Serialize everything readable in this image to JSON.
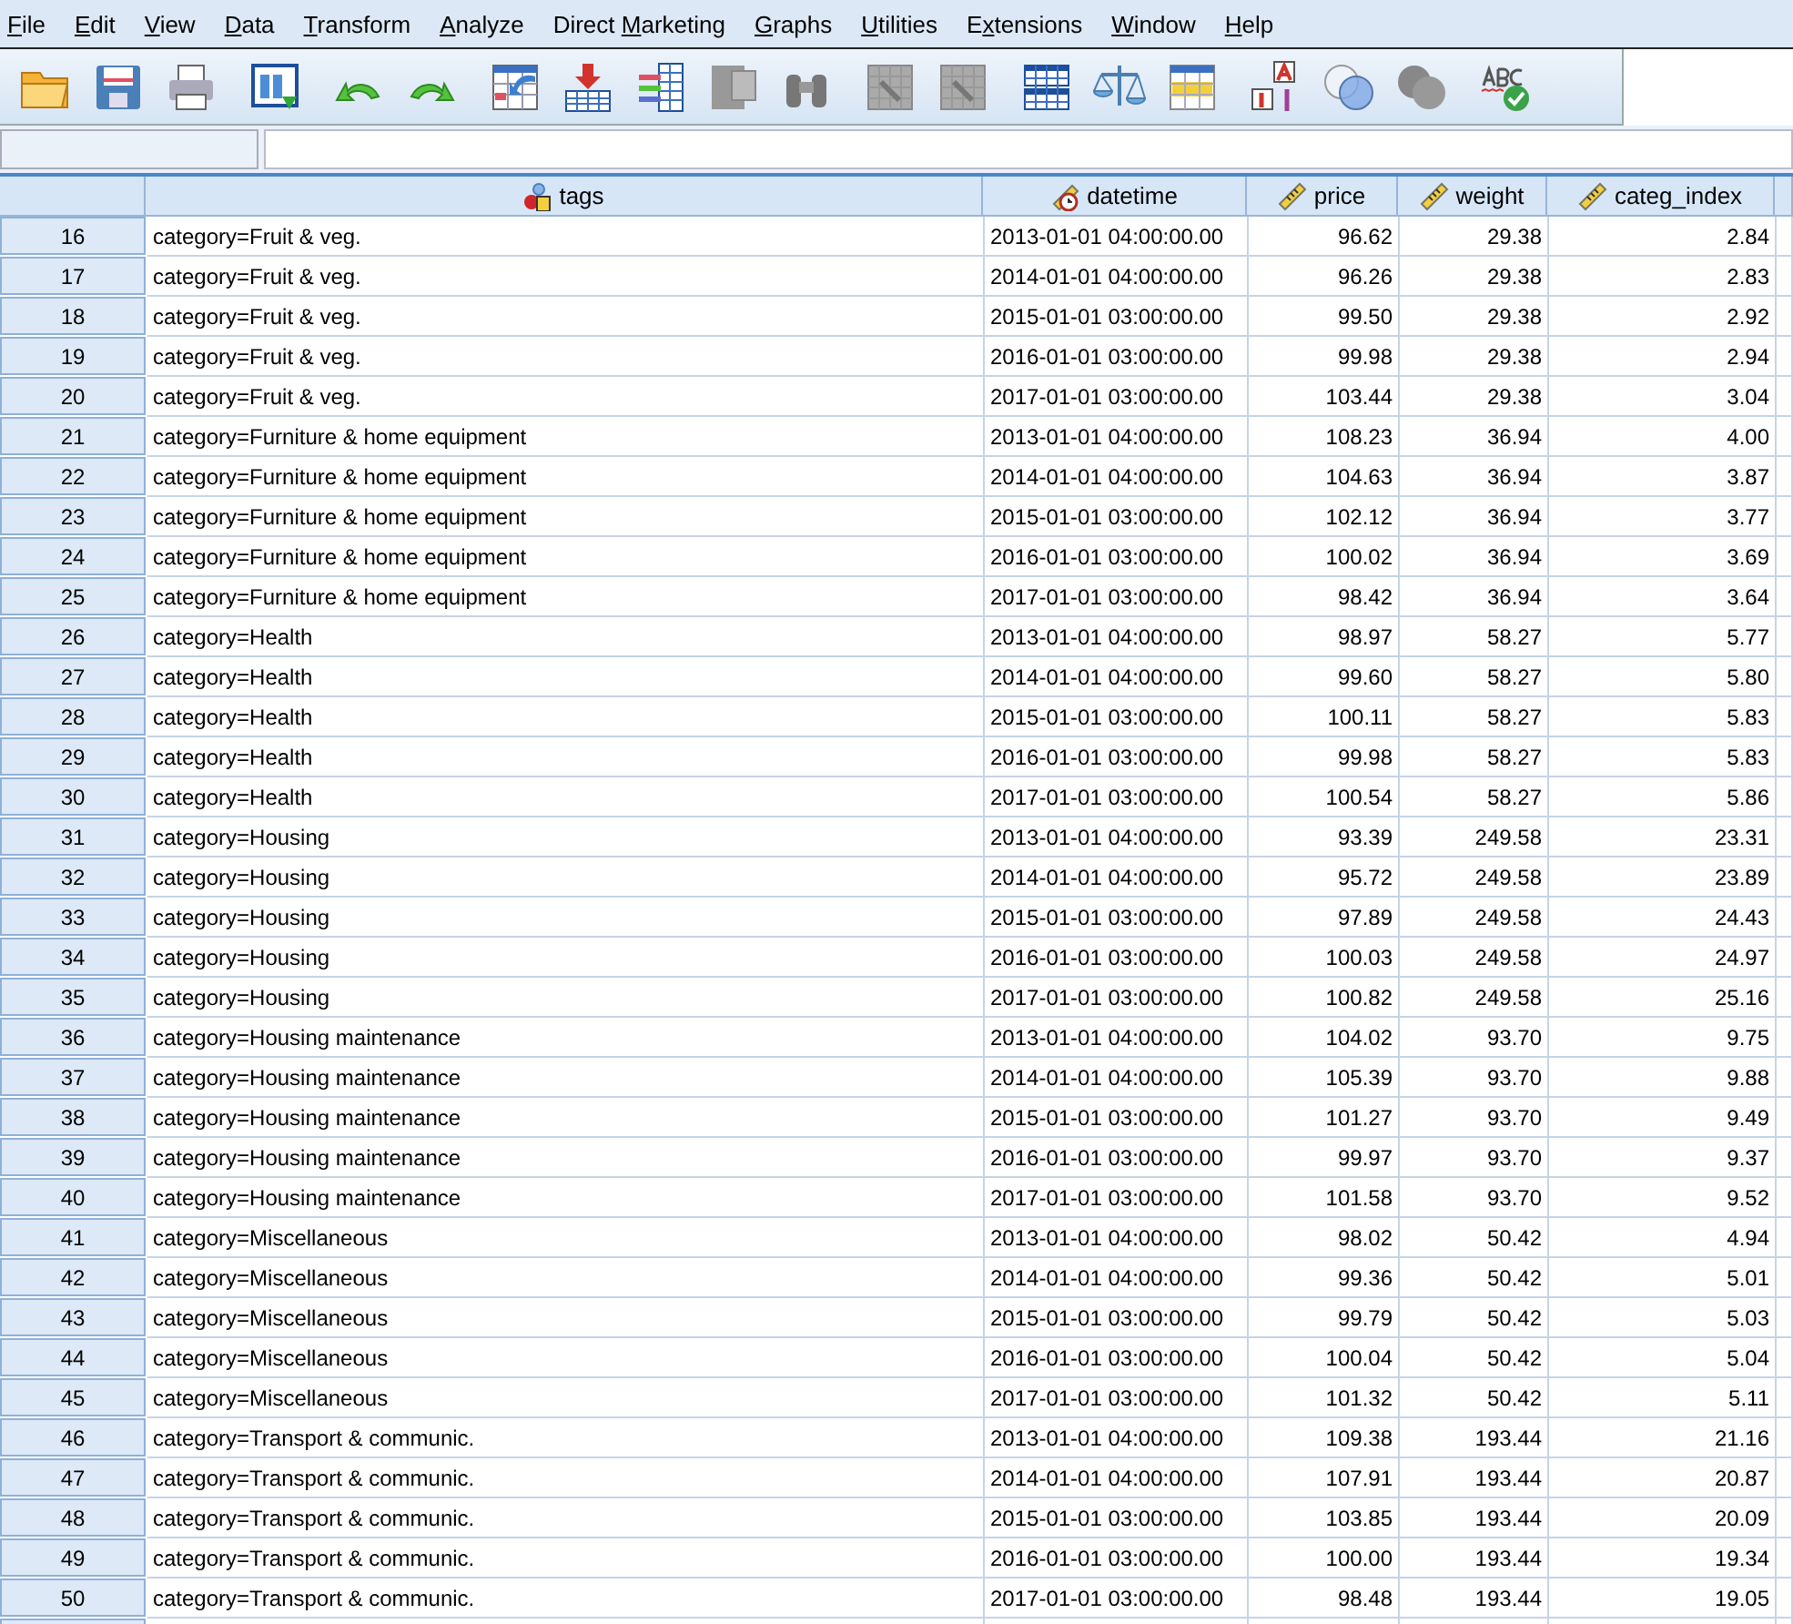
{
  "menu": [
    {
      "key": "F",
      "after": "ile"
    },
    {
      "key": "E",
      "after": "dit"
    },
    {
      "key": "V",
      "after": "iew"
    },
    {
      "key": "D",
      "after": "ata"
    },
    {
      "key": "T",
      "after": "ransform"
    },
    {
      "key": "A",
      "after": "nalyze"
    },
    {
      "before": "Direct ",
      "key": "M",
      "after": "arketing"
    },
    {
      "key": "G",
      "after": "raphs"
    },
    {
      "key": "U",
      "after": "tilities"
    },
    {
      "before": "E",
      "key": "x",
      "after": "tensions"
    },
    {
      "key": "W",
      "after": "indow"
    },
    {
      "key": "H",
      "after": "elp"
    }
  ],
  "table": {
    "columns": [
      {
        "name": "tags",
        "kind": "nominal"
      },
      {
        "name": "datetime",
        "kind": "date"
      },
      {
        "name": "price",
        "kind": "scale"
      },
      {
        "name": "weight",
        "kind": "scale"
      },
      {
        "name": "categ_index",
        "kind": "scale"
      }
    ],
    "rows": [
      {
        "case": "16",
        "cells": [
          "category=Fruit & veg.",
          "2013-01-01 04:00:00.00",
          "96.62",
          "29.38",
          "2.84"
        ]
      },
      {
        "case": "17",
        "cells": [
          "category=Fruit & veg.",
          "2014-01-01 04:00:00.00",
          "96.26",
          "29.38",
          "2.83"
        ]
      },
      {
        "case": "18",
        "cells": [
          "category=Fruit & veg.",
          "2015-01-01 03:00:00.00",
          "99.50",
          "29.38",
          "2.92"
        ]
      },
      {
        "case": "19",
        "cells": [
          "category=Fruit & veg.",
          "2016-01-01 03:00:00.00",
          "99.98",
          "29.38",
          "2.94"
        ]
      },
      {
        "case": "20",
        "cells": [
          "category=Fruit & veg.",
          "2017-01-01 03:00:00.00",
          "103.44",
          "29.38",
          "3.04"
        ]
      },
      {
        "case": "21",
        "cells": [
          "category=Furniture & home equipment",
          "2013-01-01 04:00:00.00",
          "108.23",
          "36.94",
          "4.00"
        ]
      },
      {
        "case": "22",
        "cells": [
          "category=Furniture & home equipment",
          "2014-01-01 04:00:00.00",
          "104.63",
          "36.94",
          "3.87"
        ]
      },
      {
        "case": "23",
        "cells": [
          "category=Furniture & home equipment",
          "2015-01-01 03:00:00.00",
          "102.12",
          "36.94",
          "3.77"
        ]
      },
      {
        "case": "24",
        "cells": [
          "category=Furniture & home equipment",
          "2016-01-01 03:00:00.00",
          "100.02",
          "36.94",
          "3.69"
        ]
      },
      {
        "case": "25",
        "cells": [
          "category=Furniture & home equipment",
          "2017-01-01 03:00:00.00",
          "98.42",
          "36.94",
          "3.64"
        ]
      },
      {
        "case": "26",
        "cells": [
          "category=Health",
          "2013-01-01 04:00:00.00",
          "98.97",
          "58.27",
          "5.77"
        ]
      },
      {
        "case": "27",
        "cells": [
          "category=Health",
          "2014-01-01 04:00:00.00",
          "99.60",
          "58.27",
          "5.80"
        ]
      },
      {
        "case": "28",
        "cells": [
          "category=Health",
          "2015-01-01 03:00:00.00",
          "100.11",
          "58.27",
          "5.83"
        ]
      },
      {
        "case": "29",
        "cells": [
          "category=Health",
          "2016-01-01 03:00:00.00",
          "99.98",
          "58.27",
          "5.83"
        ]
      },
      {
        "case": "30",
        "cells": [
          "category=Health",
          "2017-01-01 03:00:00.00",
          "100.54",
          "58.27",
          "5.86"
        ]
      },
      {
        "case": "31",
        "cells": [
          "category=Housing",
          "2013-01-01 04:00:00.00",
          "93.39",
          "249.58",
          "23.31"
        ]
      },
      {
        "case": "32",
        "cells": [
          "category=Housing",
          "2014-01-01 04:00:00.00",
          "95.72",
          "249.58",
          "23.89"
        ]
      },
      {
        "case": "33",
        "cells": [
          "category=Housing",
          "2015-01-01 03:00:00.00",
          "97.89",
          "249.58",
          "24.43"
        ]
      },
      {
        "case": "34",
        "cells": [
          "category=Housing",
          "2016-01-01 03:00:00.00",
          "100.03",
          "249.58",
          "24.97"
        ]
      },
      {
        "case": "35",
        "cells": [
          "category=Housing",
          "2017-01-01 03:00:00.00",
          "100.82",
          "249.58",
          "25.16"
        ]
      },
      {
        "case": "36",
        "cells": [
          "category=Housing maintenance",
          "2013-01-01 04:00:00.00",
          "104.02",
          "93.70",
          "9.75"
        ]
      },
      {
        "case": "37",
        "cells": [
          "category=Housing maintenance",
          "2014-01-01 04:00:00.00",
          "105.39",
          "93.70",
          "9.88"
        ]
      },
      {
        "case": "38",
        "cells": [
          "category=Housing maintenance",
          "2015-01-01 03:00:00.00",
          "101.27",
          "93.70",
          "9.49"
        ]
      },
      {
        "case": "39",
        "cells": [
          "category=Housing maintenance",
          "2016-01-01 03:00:00.00",
          "99.97",
          "93.70",
          "9.37"
        ]
      },
      {
        "case": "40",
        "cells": [
          "category=Housing maintenance",
          "2017-01-01 03:00:00.00",
          "101.58",
          "93.70",
          "9.52"
        ]
      },
      {
        "case": "41",
        "cells": [
          "category=Miscellaneous",
          "2013-01-01 04:00:00.00",
          "98.02",
          "50.42",
          "4.94"
        ]
      },
      {
        "case": "42",
        "cells": [
          "category=Miscellaneous",
          "2014-01-01 04:00:00.00",
          "99.36",
          "50.42",
          "5.01"
        ]
      },
      {
        "case": "43",
        "cells": [
          "category=Miscellaneous",
          "2015-01-01 03:00:00.00",
          "99.79",
          "50.42",
          "5.03"
        ]
      },
      {
        "case": "44",
        "cells": [
          "category=Miscellaneous",
          "2016-01-01 03:00:00.00",
          "100.04",
          "50.42",
          "5.04"
        ]
      },
      {
        "case": "45",
        "cells": [
          "category=Miscellaneous",
          "2017-01-01 03:00:00.00",
          "101.32",
          "50.42",
          "5.11"
        ]
      },
      {
        "case": "46",
        "cells": [
          "category=Transport & communic.",
          "2013-01-01 04:00:00.00",
          "109.38",
          "193.44",
          "21.16"
        ]
      },
      {
        "case": "47",
        "cells": [
          "category=Transport & communic.",
          "2014-01-01 04:00:00.00",
          "107.91",
          "193.44",
          "20.87"
        ]
      },
      {
        "case": "48",
        "cells": [
          "category=Transport & communic.",
          "2015-01-01 03:00:00.00",
          "103.85",
          "193.44",
          "20.09"
        ]
      },
      {
        "case": "49",
        "cells": [
          "category=Transport & communic.",
          "2016-01-01 03:00:00.00",
          "100.00",
          "193.44",
          "19.34"
        ]
      },
      {
        "case": "50",
        "cells": [
          "category=Transport & communic.",
          "2017-01-01 03:00:00.00",
          "98.48",
          "193.44",
          "19.05"
        ]
      }
    ]
  }
}
